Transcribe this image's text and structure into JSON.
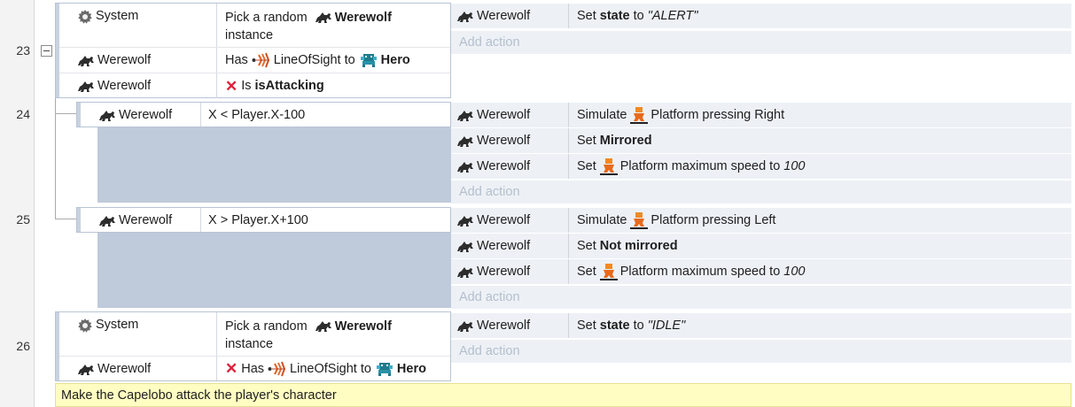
{
  "line_numbers": [
    "23",
    "24",
    "25",
    "26"
  ],
  "icons": {
    "system": "gear-icon",
    "werewolf": "werewolf-sprite-icon",
    "hero": "hero-sprite-icon",
    "line_of_sight": "line-of-sight-icon",
    "platform": "platform-behavior-icon",
    "not": "red-x-icon"
  },
  "colors": {
    "action_row_bg": "#edf1f6",
    "sub_event_filler": "#bfcadb",
    "comment_bg": "#fffdc2",
    "add_action_text": "#b4bfcc",
    "inverted_x": "#e0203a"
  },
  "events": {
    "e23": {
      "conditions": {
        "c1": {
          "object": "System",
          "pre": "Pick a random",
          "target": "Werewolf",
          "post": "instance"
        },
        "c2": {
          "object": "Werewolf",
          "pre": "Has",
          "behavior": "LineOfSight",
          "mid": "to",
          "target": "Hero"
        },
        "c3": {
          "object": "Werewolf",
          "pre": "Is",
          "value": "isAttacking"
        }
      },
      "actions": {
        "a1": {
          "object": "Werewolf",
          "pre": "Set",
          "var": "state",
          "mid": "to",
          "value": "\"ALERT\""
        }
      },
      "add_action": "Add action"
    },
    "e24": {
      "conditions": {
        "c1": {
          "object": "Werewolf",
          "text": "X < Player.X-100"
        }
      },
      "actions": {
        "a1": {
          "object": "Werewolf",
          "pre": "Simulate",
          "behavior": "Platform",
          "post": "pressing Right"
        },
        "a2": {
          "object": "Werewolf",
          "pre": "Set",
          "value": "Mirrored"
        },
        "a3": {
          "object": "Werewolf",
          "pre": "Set",
          "behavior": "Platform",
          "mid": "maximum speed to",
          "value": "100"
        }
      },
      "add_action": "Add action"
    },
    "e25": {
      "conditions": {
        "c1": {
          "object": "Werewolf",
          "text": "X > Player.X+100"
        }
      },
      "actions": {
        "a1": {
          "object": "Werewolf",
          "pre": "Simulate",
          "behavior": "Platform",
          "post": "pressing Left"
        },
        "a2": {
          "object": "Werewolf",
          "pre": "Set",
          "value": "Not mirrored"
        },
        "a3": {
          "object": "Werewolf",
          "pre": "Set",
          "behavior": "Platform",
          "mid": "maximum speed to",
          "value": "100"
        }
      },
      "add_action": "Add action"
    },
    "e26": {
      "conditions": {
        "c1": {
          "object": "System",
          "pre": "Pick a random",
          "target": "Werewolf",
          "post": "instance"
        },
        "c2": {
          "object": "Werewolf",
          "pre": "Has",
          "behavior": "LineOfSight",
          "mid": "to",
          "target": "Hero"
        }
      },
      "actions": {
        "a1": {
          "object": "Werewolf",
          "pre": "Set",
          "var": "state",
          "mid": "to",
          "value": "\"IDLE\""
        }
      },
      "add_action": "Add action"
    }
  },
  "comment": "Make the Capelobo attack the player's character"
}
